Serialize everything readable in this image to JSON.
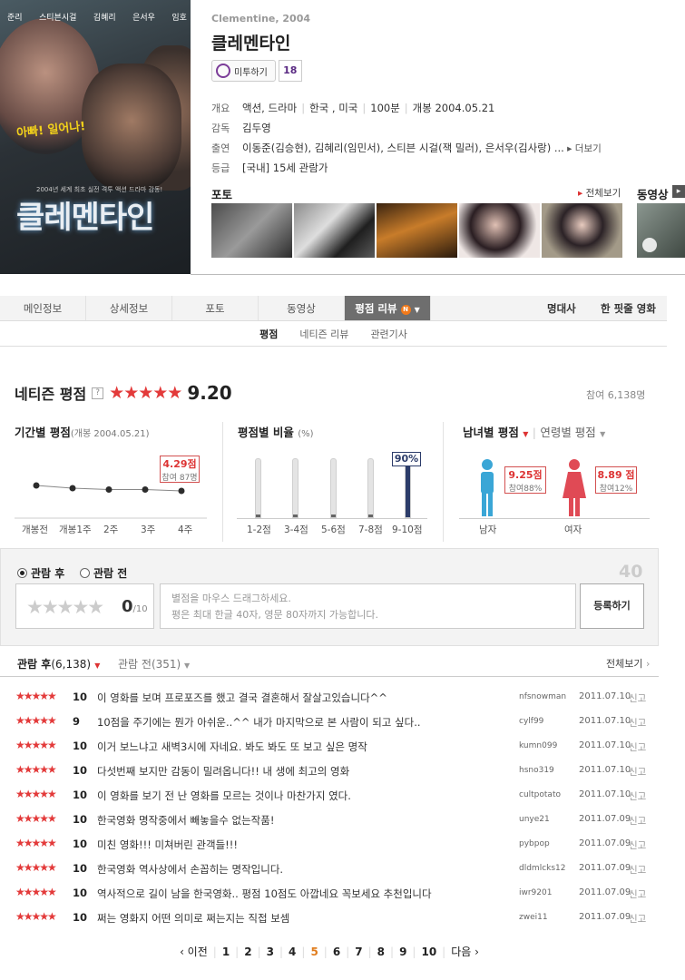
{
  "poster": {
    "names": [
      "준리",
      "스티븐시걸",
      "김혜리",
      "은서우",
      "임호"
    ],
    "tagline": "아빠! 일어나!",
    "title": "클레멘타인",
    "blurb": "2004년 세계 최초 실전 격투 액션 드라마 감동!"
  },
  "movie": {
    "eng_title": "Clementine, 2004",
    "title": "클레멘타인",
    "mitu_label": "미투하기",
    "mitu_count": "18"
  },
  "info": {
    "rows": [
      {
        "key": "개요",
        "values": [
          "액션, 드라마",
          "한국 , 미국",
          "100분",
          "개봉 2004.05.21"
        ]
      },
      {
        "key": "감독",
        "values": [
          "김두영"
        ]
      },
      {
        "key": "출연",
        "values": [
          "이동준(김승현), 김혜리(임민서), 스티븐 시걸(잭 밀러), 은서우(김사랑) ..."
        ],
        "more": "더보기"
      },
      {
        "key": "등급",
        "values": [
          "[국내] 15세 관람가"
        ]
      }
    ]
  },
  "photo_section": {
    "title": "포토",
    "see_all": "전체보기"
  },
  "video_section": {
    "title": "동영상"
  },
  "tabs": {
    "items": [
      "메인정보",
      "상세정보",
      "포토",
      "동영상",
      "평점 리뷰"
    ],
    "new_badge": "N",
    "right": [
      "명대사",
      "한 핏줄 영화"
    ]
  },
  "subtabs": [
    "평점",
    "네티즌 리뷰",
    "관련기사"
  ],
  "netizen": {
    "title": "네티즌 평점",
    "help": "?",
    "stars": "★★★★★",
    "score": "9.20",
    "participants": "참여 6,138명"
  },
  "period": {
    "title": "기간별 평점",
    "sub": "(개봉 2004.05.21)",
    "labels": [
      "개봉전",
      "개봉1주",
      "2주",
      "3주",
      "4주"
    ],
    "values": [
      9.4,
      9.2,
      9.1,
      9.1,
      9.0
    ],
    "callout_score": "4.29점",
    "callout_count": "참여 87명"
  },
  "ratio": {
    "title": "평점별 비율",
    "sub": "(%)",
    "labels": [
      "1-2점",
      "3-4점",
      "5-6점",
      "7-8점",
      "9-10점"
    ],
    "values": [
      3,
      1,
      1,
      2,
      90
    ],
    "top_label": "90%"
  },
  "gender": {
    "title": "남녀별 평점",
    "title2": "연령별 평점",
    "male": {
      "label": "남자",
      "score": "9.25점",
      "part": "참여88%"
    },
    "female": {
      "label": "여자",
      "score": "8.89 점",
      "part": "참여12%"
    },
    "colors": {
      "male": "#3aa6d6",
      "female": "#e04a55"
    }
  },
  "write": {
    "after": "관람 후",
    "before": "관람 전",
    "max_chars": "40",
    "empty_stars": "★★★★★",
    "score": "0",
    "score_max": "/10",
    "placeholder_line1": "별점을 마우스 드래그하세요.",
    "placeholder_line2": "평은 최대 한글 40자, 영문 80자까지 가능합니다.",
    "submit": "등록하기"
  },
  "list": {
    "after_label": "관람 후",
    "after_count": "(6,138)",
    "before_label": "관람 전",
    "before_count": "(351)",
    "see_all": "전체보기",
    "report": "신고",
    "reviews": [
      {
        "stars": "★★★★★",
        "score": "10",
        "text": "이 영화를 보며 프로포즈를 했고 결국 결혼해서 잘살고있습니다^^",
        "user": "nfsnowman",
        "date": "2011.07.10"
      },
      {
        "stars": "★★★★★",
        "score": "9",
        "text": "10점을 주기에는 뭔가 아쉬운..^^ 내가 마지막으로 본 사람이 되고 싶다..",
        "user": "cylf99",
        "date": "2011.07.10"
      },
      {
        "stars": "★★★★★",
        "score": "10",
        "text": "이거 보느냐고 새벽3시에 자네요. 봐도 봐도 또 보고 싶은 명작",
        "user": "kumn099",
        "date": "2011.07.10"
      },
      {
        "stars": "★★★★★",
        "score": "10",
        "text": "다섯번째 보지만 감동이 밀려옵니다!! 내 생에 최고의 영화",
        "user": "hsno319",
        "date": "2011.07.10"
      },
      {
        "stars": "★★★★★",
        "score": "10",
        "text": "이 영화를 보기 전 난 영화를 모르는 것이나 마찬가지 였다.",
        "user": "cultpotato",
        "date": "2011.07.10"
      },
      {
        "stars": "★★★★★",
        "score": "10",
        "text": "한국영화 명작중에서 빼놓을수 없는작품!",
        "user": "unye21",
        "date": "2011.07.09"
      },
      {
        "stars": "★★★★★",
        "score": "10",
        "text": "미친 영화!!! 미쳐버린 관객들!!!",
        "user": "pybpop",
        "date": "2011.07.09"
      },
      {
        "stars": "★★★★★",
        "score": "10",
        "text": "한국영화 역사상에서 손꼽히는 명작입니다.",
        "user": "dldmlcks12",
        "date": "2011.07.09"
      },
      {
        "stars": "★★★★★",
        "score": "10",
        "text": "역사적으로 길이 남을 한국영화.. 평점 10점도 아깝네요 꼭보세요 추천입니다",
        "user": "iwr9201",
        "date": "2011.07.09"
      },
      {
        "stars": "★★★★★",
        "score": "10",
        "text": "쩌는 영화지 어떤 의미로 쩌는지는 직접 보셈",
        "user": "zwei11",
        "date": "2011.07.09"
      }
    ]
  },
  "pager": {
    "prev": "‹ 이전",
    "next": "다음 ›",
    "pages": [
      "1",
      "2",
      "3",
      "4",
      "5",
      "6",
      "7",
      "8",
      "9",
      "10"
    ],
    "current": "5"
  }
}
